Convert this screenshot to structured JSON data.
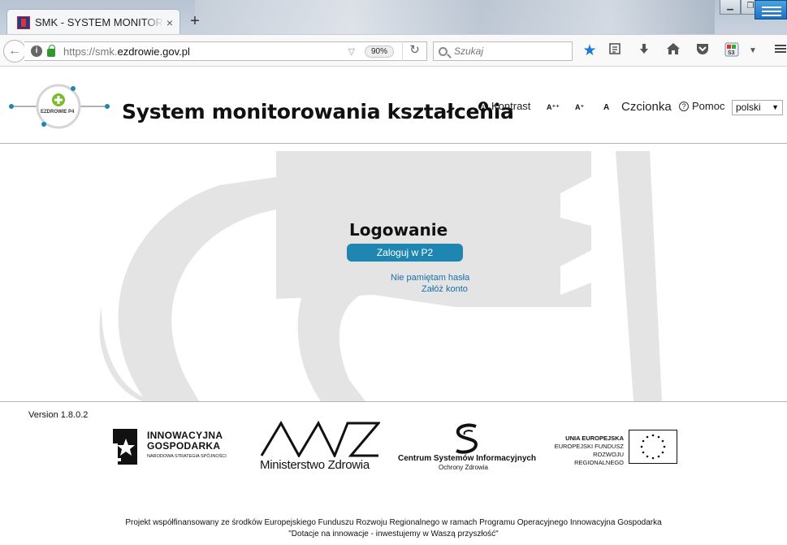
{
  "browser": {
    "tab_title": "SMK - SYSTEM MONITOROWANIA KSZTAŁCENIA",
    "tab_close": "×",
    "new_tab": "+",
    "url_prefix": "https://smk.",
    "url_domain": "ezdrowie.gov.pl",
    "zoom": "90%",
    "search_placeholder": "Szukaj"
  },
  "header": {
    "logo_text": "EZDROWIE P4",
    "site_title": "System monitorowania kształcenia",
    "contrast_label": "Kontrast",
    "font_larger": "A⁺⁺",
    "font_medium": "A⁺",
    "font_normal": "A",
    "font_label": "Czcionka",
    "help_label": "Pomoc",
    "language": "polski"
  },
  "login": {
    "title": "Logowanie",
    "login_button": "Zaloguj w P2",
    "forgot_password": "Nie pamiętam hasła",
    "register": "Załóż konto"
  },
  "footer": {
    "version": "Version 1.8.0.2",
    "logo_ig_line1": "INNOWACYJNA",
    "logo_ig_line2": "GOSPODARKA",
    "logo_ig_line3": "NARODOWA STRATEGIA SPÓJNOŚCI",
    "logo_mz": "Ministerstwo Zdrowia",
    "logo_csioz_line1": "Centrum Systemów Informacyjnych",
    "logo_csioz_line2": "Ochrony Zdrowia",
    "logo_ue_line1": "UNIA EUROPEJSKA",
    "logo_ue_line2": "EUROPEJSKI FUNDUSZ",
    "logo_ue_line3": "ROZWOJU REGIONALNEGO",
    "funding_line1": "Projekt współfinansowany ze środków Europejskiego Funduszu Rozwoju Regionalnego w ramach Programu Operacyjnego Innowacyjna Gospodarka",
    "funding_line2": "\"Dotacje na innowacje - inwestujemy w Waszą przyszłość\""
  },
  "colors": {
    "login_button": "#1e86b0",
    "link": "#1a6fa8",
    "watermark": "#e4e4e4",
    "logo_green": "#7dbb2a",
    "logo_blue": "#1e86b0"
  }
}
